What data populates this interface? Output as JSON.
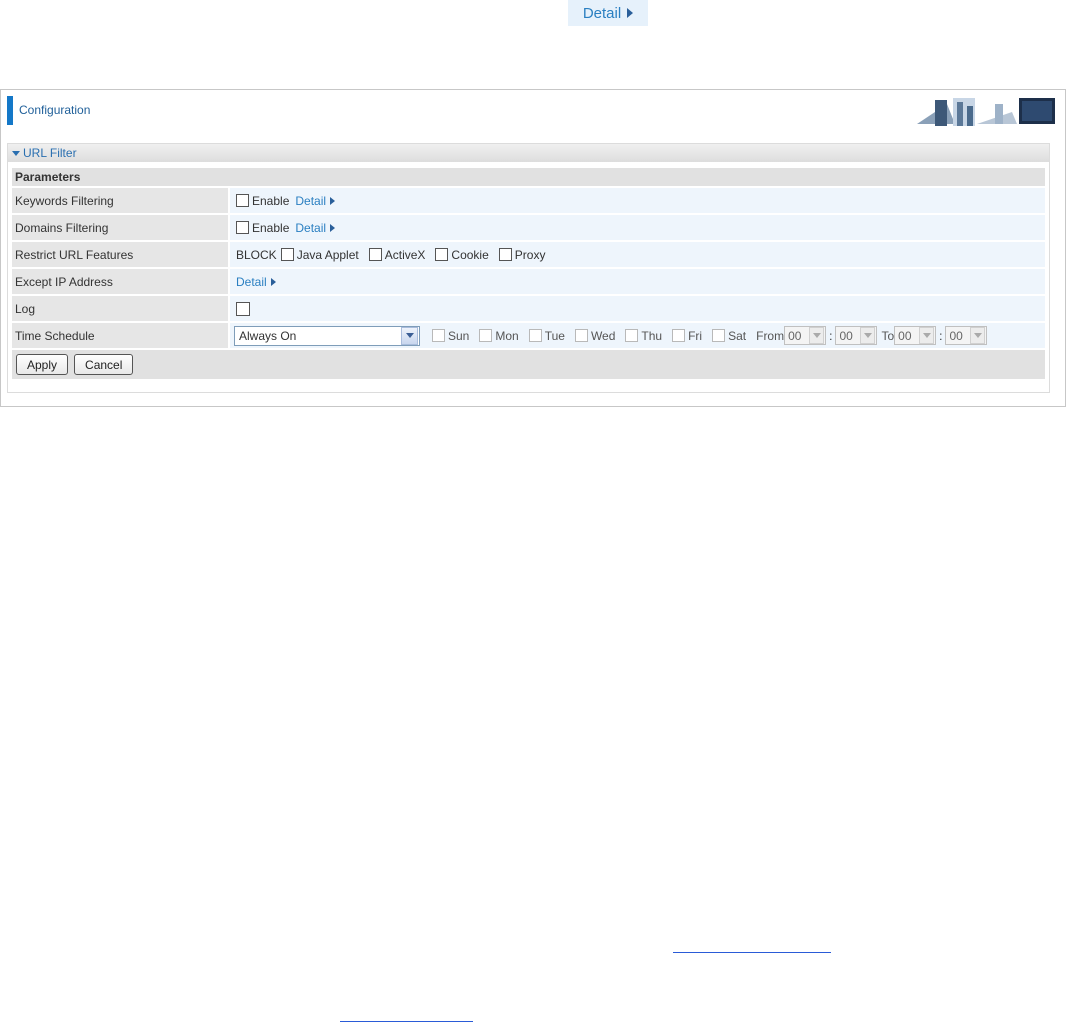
{
  "top_detail": {
    "label": "Detail"
  },
  "config": {
    "title": "Configuration"
  },
  "url_filter": {
    "title": "URL Filter",
    "parameters_header": "Parameters",
    "rows": {
      "keywords": {
        "label": "Keywords Filtering",
        "enable_label": "Enable",
        "detail_label": "Detail"
      },
      "domains": {
        "label": "Domains Filtering",
        "enable_label": "Enable",
        "detail_label": "Detail"
      },
      "restrict": {
        "label": "Restrict URL Features",
        "block_label": "BLOCK",
        "options": [
          "Java Applet",
          "ActiveX",
          "Cookie",
          "Proxy"
        ]
      },
      "except_ip": {
        "label": "Except IP Address",
        "detail_label": "Detail"
      },
      "log": {
        "label": "Log"
      },
      "schedule": {
        "label": "Time Schedule",
        "selected": "Always On",
        "days": [
          "Sun",
          "Mon",
          "Tue",
          "Wed",
          "Thu",
          "Fri",
          "Sat"
        ],
        "from_label": "From",
        "to_label": "To",
        "sep": ":",
        "from_hour": "00",
        "from_min": "00",
        "to_hour": "00",
        "to_min": "00"
      }
    },
    "buttons": {
      "apply": "Apply",
      "cancel": "Cancel"
    }
  },
  "colors": {
    "accent": "#1478c8",
    "link": "#2a7fc1",
    "row_value_bg": "#eef5fc",
    "row_label_bg": "#e6e6e6"
  }
}
